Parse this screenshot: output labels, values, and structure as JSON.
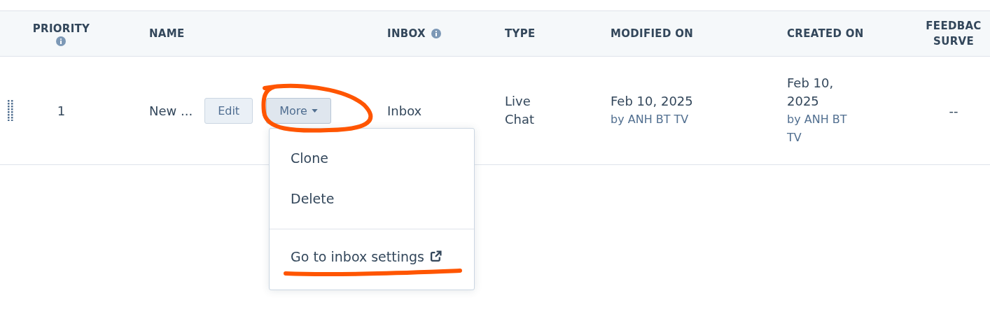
{
  "table": {
    "columns": [
      {
        "label": "PRIORITY",
        "info": true
      },
      {
        "label": "NAME",
        "info": false
      },
      {
        "label": "INBOX",
        "info": true
      },
      {
        "label": "TYPE",
        "info": false
      },
      {
        "label": "MODIFIED ON",
        "info": false
      },
      {
        "label": "CREATED ON",
        "info": false
      },
      {
        "label": "FEEDBAC\nSURVE",
        "info": false
      }
    ],
    "rows": [
      {
        "priority": "1",
        "name": "New ...",
        "actions": [
          {
            "label": "Edit",
            "kind": "button"
          },
          {
            "label": "More",
            "kind": "dropdown",
            "expanded": true
          }
        ],
        "inbox": "Inbox",
        "type": "Live Chat",
        "modified": {
          "date": "Feb 10, 2025",
          "by": "by ANH BT TV"
        },
        "created": {
          "date": "Feb 10, 2025",
          "by": "by ANH BT TV"
        },
        "feedback": "--"
      }
    ]
  },
  "menu": {
    "items": [
      {
        "label": "Clone",
        "kind": "action"
      },
      {
        "label": "Delete",
        "kind": "action"
      },
      {
        "label": "Go to inbox settings",
        "kind": "external"
      }
    ]
  }
}
